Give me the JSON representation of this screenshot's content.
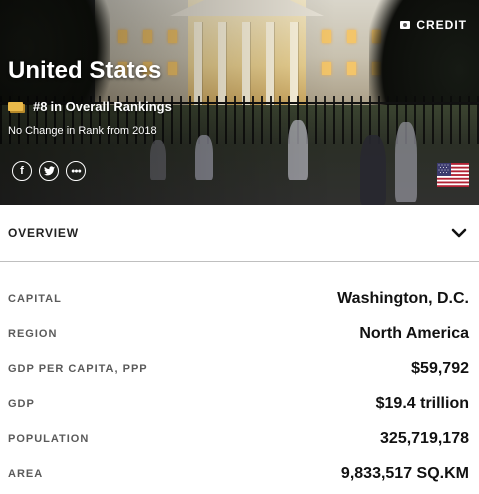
{
  "hero": {
    "credit_label": "CREDIT",
    "credit_icon": "camera-icon",
    "country_name": "United States",
    "rank_number": "#8",
    "rank_text": "in Overall Rankings",
    "rank_change": "No Change in Rank from 2018",
    "social": [
      {
        "name": "facebook",
        "glyph": "f"
      },
      {
        "name": "twitter",
        "glyph": "t"
      },
      {
        "name": "more",
        "glyph": "•••"
      }
    ],
    "flag": "united-states-flag"
  },
  "overview": {
    "label": "OVERVIEW",
    "icon": "chevron-down-icon"
  },
  "facts": [
    {
      "label": "CAPITAL",
      "value": "Washington, D.C."
    },
    {
      "label": "REGION",
      "value": "North America"
    },
    {
      "label": "GDP PER CAPITA, PPP",
      "value": "$59,792"
    },
    {
      "label": "GDP",
      "value": "$19.4 trillion"
    },
    {
      "label": "POPULATION",
      "value": "325,719,178"
    },
    {
      "label": "AREA",
      "value": "9,833,517 SQ.KM"
    }
  ],
  "colors": {
    "rank_icon": "#e9b94a",
    "flag_red": "#b22234",
    "flag_blue": "#3c3b6e"
  }
}
